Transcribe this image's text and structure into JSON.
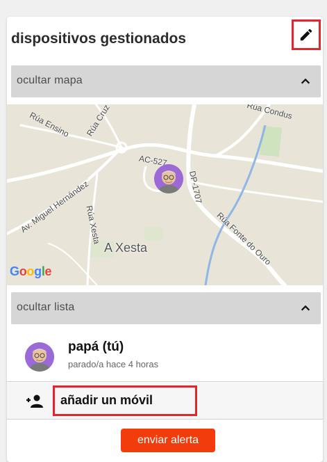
{
  "header": {
    "title": "dispositivos gestionados",
    "edit_icon": "pencil-icon"
  },
  "map_toggle": {
    "label": "ocultar mapa",
    "icon": "chevron-up-icon"
  },
  "map": {
    "labels": {
      "rua_ensino": "Rúa Ensino",
      "rua_cruz": "Rúa Cruz",
      "rua_condus": "Rúa Condus",
      "ac527": "AC-527",
      "dp1707": "DP-1707",
      "miguel": "Av. Miguel Hernández",
      "rua_xesta": "Rúa Xesta",
      "fonte": "Rúa Fonte do Ouro",
      "a_xesta": "A Xesta"
    },
    "attribution": "Google"
  },
  "list_toggle": {
    "label": "ocultar lista",
    "icon": "chevron-up-icon"
  },
  "devices": [
    {
      "name": "papá (tú)",
      "status": "parado/a hace 4 horas"
    }
  ],
  "add_device": {
    "label": "añadir un móvil",
    "icon": "add-person-icon"
  },
  "alert_button": {
    "label": "enviar alerta"
  },
  "colors": {
    "accent": "#f23c0c",
    "highlight": "#e3262b",
    "avatar": "#9b6ad6"
  }
}
